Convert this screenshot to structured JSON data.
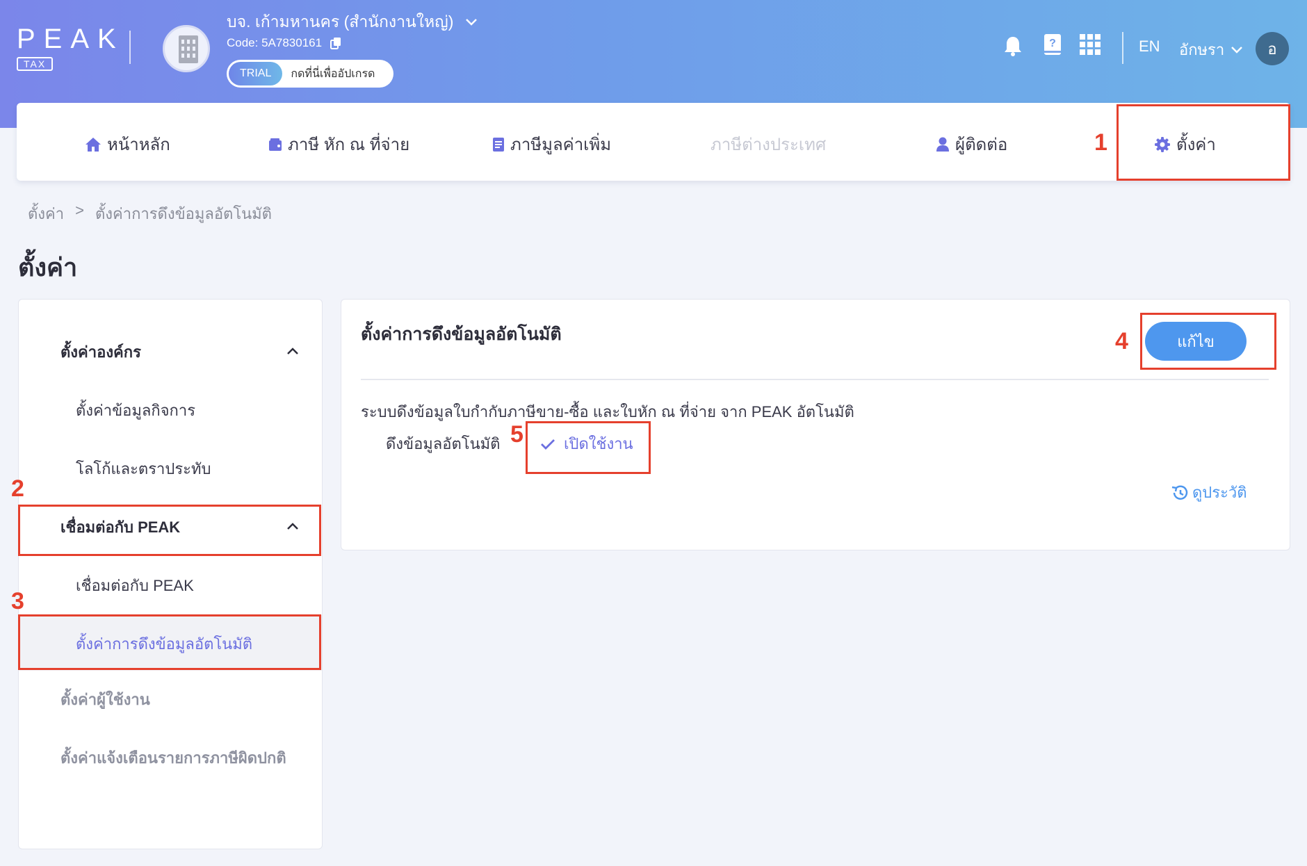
{
  "app": {
    "logo_word": "PEAK",
    "logo_sub": "TAX",
    "company_name": "บจ. เก้ามหานคร (สำนักงานใหญ่)",
    "company_code": "Code: 5A7830161",
    "trial_tag": "TRIAL",
    "trial_text": "กดที่นี่เพื่ออัปเกรด",
    "lang": "EN",
    "user_name": "อักษรา",
    "user_initial": "อ"
  },
  "nav": {
    "home": "หน้าหลัก",
    "wht": "ภาษี หัก ณ ที่จ่าย",
    "vat": "ภาษีมูลค่าเพิ่ม",
    "foreign": "ภาษีต่างประเทศ",
    "contacts": "ผู้ติดต่อ",
    "settings": "ตั้งค่า"
  },
  "breadcrumb": {
    "root": "ตั้งค่า",
    "sep": ">",
    "current": "ตั้งค่าการดึงข้อมูลอัตโนมัติ"
  },
  "page_title": "ตั้งค่า",
  "sidebar": {
    "group_org": "ตั้งค่าองค์กร",
    "item_business": "ตั้งค่าข้อมูลกิจการ",
    "item_logo": "โลโก้และตราประทับ",
    "group_peak": "เชื่อมต่อกับ PEAK",
    "item_connect": "เชื่อมต่อกับ PEAK",
    "item_auto": "ตั้งค่าการดึงข้อมูลอัตโนมัติ",
    "group_users": "ตั้งค่าผู้ใช้งาน",
    "group_alerts": "ตั้งค่าแจ้งเตือนรายการภาษีผิดปกติ"
  },
  "panel": {
    "title": "ตั้งค่าการดึงข้อมูลอัตโนมัติ",
    "edit_label": "แก้ไข",
    "description": "ระบบดึงข้อมูลใบกำกับภาษีขาย-ซื้อ และใบหัก ณ ที่จ่าย จาก PEAK อัตโนมัติ",
    "auto_label": "ดึงข้อมูลอัตโนมัติ",
    "status": "เปิดใช้งาน",
    "history": "ดูประวัติ"
  },
  "annotations": [
    "1",
    "2",
    "3",
    "4",
    "5"
  ],
  "colors": {
    "accent": "#6b6fe0",
    "primary_button": "#4e97ee",
    "annotation": "#e5402d"
  },
  "icons": [
    "home-icon",
    "wallet-icon",
    "document-icon",
    "person-icon",
    "gear-icon",
    "bell-icon",
    "help-book-icon",
    "apps-grid-icon",
    "copy-icon",
    "check-icon",
    "history-icon",
    "chevron-up-icon",
    "chevron-down-icon"
  ]
}
